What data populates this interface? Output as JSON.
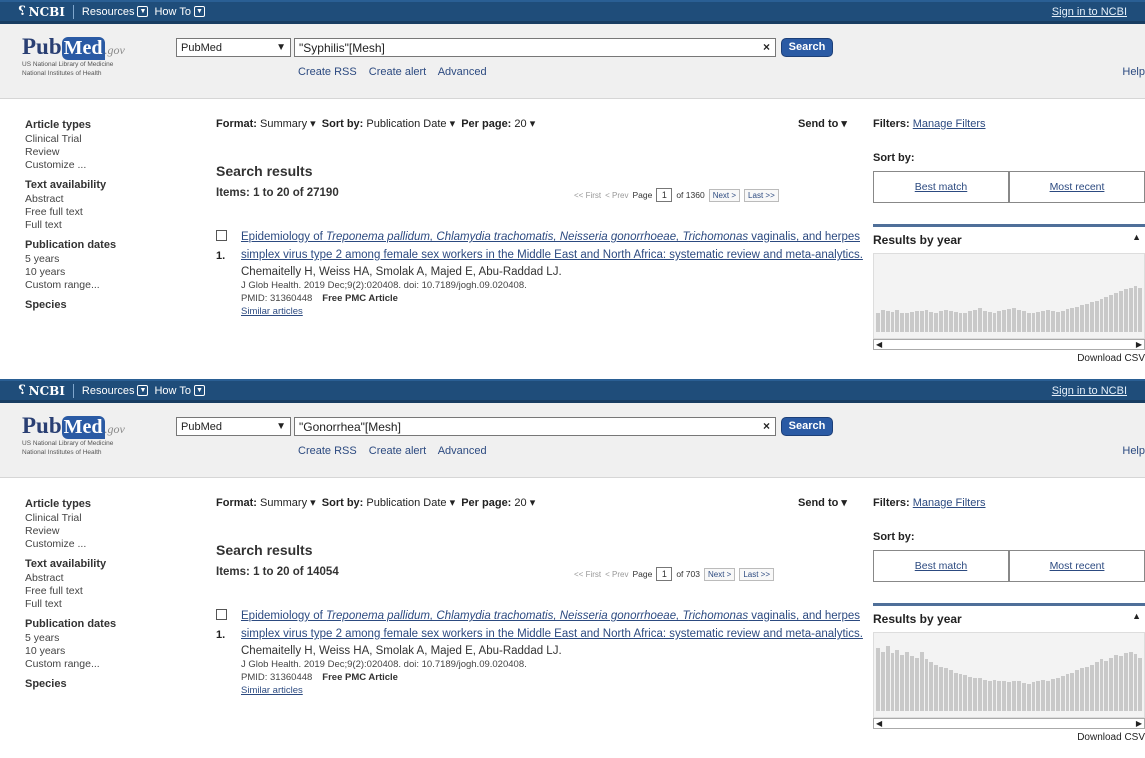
{
  "topbar": {
    "ncbi_label": "NCBI",
    "resources_label": "Resources",
    "howto_label": "How To",
    "signin_label": "Sign in to NCBI"
  },
  "logo": {
    "pub": "Pub",
    "med": "Med",
    "gov": ".gov",
    "line1": "US National Library of Medicine",
    "line2": "National Institutes of Health"
  },
  "common": {
    "db_value": "PubMed",
    "search_button": "Search",
    "links": [
      "Create RSS",
      "Create alert",
      "Advanced"
    ],
    "help": "Help",
    "sidebar": [
      {
        "heading": "Article types",
        "items": [
          "Clinical Trial",
          "Review",
          "Customize ..."
        ]
      },
      {
        "heading": "Text availability",
        "items": [
          "Abstract",
          "Free full text",
          "Full text"
        ]
      },
      {
        "heading": "Publication dates",
        "items": [
          "5 years",
          "10 years",
          "Custom range..."
        ]
      },
      {
        "heading": "Species",
        "items": []
      }
    ],
    "format_label": "Format:",
    "format_value": "Summary",
    "sort_label": "Sort by:",
    "sort_value": "Publication Date",
    "perpage_label": "Per page:",
    "perpage_value": "20",
    "sendto_label": "Send to",
    "results_title": "Search results",
    "pager": {
      "first": "<< First",
      "prev": "< Prev",
      "page_label": "Page",
      "page_value": "1",
      "next": "Next >",
      "last": "Last >>"
    },
    "filters_label": "Filters:",
    "manage_filters": "Manage Filters",
    "sortby_label": "Sort by:",
    "best_match": "Best match",
    "most_recent": "Most recent",
    "results_by_year": "Results by year",
    "download": "Download CSV",
    "result": {
      "number": "1.",
      "title_parts": [
        "Epidemiology of ",
        "Treponema pallidum, Chlamydia trachomatis, Neisseria gonorrhoeae, Trichomonas",
        " vaginalis, and herpes simplex virus type 2 among female sex workers in the Middle East and North Africa: systematic review and meta-analytics."
      ],
      "authors": "Chemaitelly H, Weiss HA, Smolak A, Majed E, Abu-Raddad LJ.",
      "journal": "J Glob Health. 2019 Dec;9(2):020408. doi: 10.7189/jogh.09.020408.",
      "pmid": "PMID: 31360448",
      "free_pmc": "Free PMC Article",
      "similar": "Similar articles"
    }
  },
  "panels": [
    {
      "query": "\"Syphilis\"[Mesh]",
      "items_text": "Items: 1 to 20 of 27190",
      "page_of": "of 1360",
      "histogram": [
        0.25,
        0.3,
        0.28,
        0.27,
        0.3,
        0.26,
        0.25,
        0.27,
        0.29,
        0.28,
        0.3,
        0.27,
        0.26,
        0.28,
        0.3,
        0.29,
        0.27,
        0.26,
        0.25,
        0.28,
        0.3,
        0.32,
        0.29,
        0.27,
        0.26,
        0.28,
        0.3,
        0.31,
        0.33,
        0.3,
        0.28,
        0.26,
        0.25,
        0.27,
        0.29,
        0.3,
        0.28,
        0.27,
        0.29,
        0.31,
        0.33,
        0.34,
        0.36,
        0.38,
        0.4,
        0.42,
        0.44,
        0.47,
        0.5,
        0.53,
        0.56,
        0.58,
        0.6,
        0.62,
        0.6
      ]
    },
    {
      "query": "\"Gonorrhea\"[Mesh]",
      "items_text": "Items: 1 to 20 of 14054",
      "page_of": "of 703",
      "histogram": [
        0.85,
        0.8,
        0.88,
        0.78,
        0.82,
        0.76,
        0.8,
        0.74,
        0.72,
        0.8,
        0.7,
        0.66,
        0.62,
        0.6,
        0.58,
        0.55,
        0.52,
        0.5,
        0.48,
        0.46,
        0.45,
        0.44,
        0.42,
        0.4,
        0.42,
        0.41,
        0.4,
        0.39,
        0.41,
        0.4,
        0.38,
        0.37,
        0.39,
        0.4,
        0.42,
        0.41,
        0.43,
        0.45,
        0.47,
        0.5,
        0.52,
        0.55,
        0.58,
        0.6,
        0.62,
        0.66,
        0.7,
        0.68,
        0.72,
        0.75,
        0.74,
        0.78,
        0.8,
        0.77,
        0.72
      ]
    }
  ]
}
